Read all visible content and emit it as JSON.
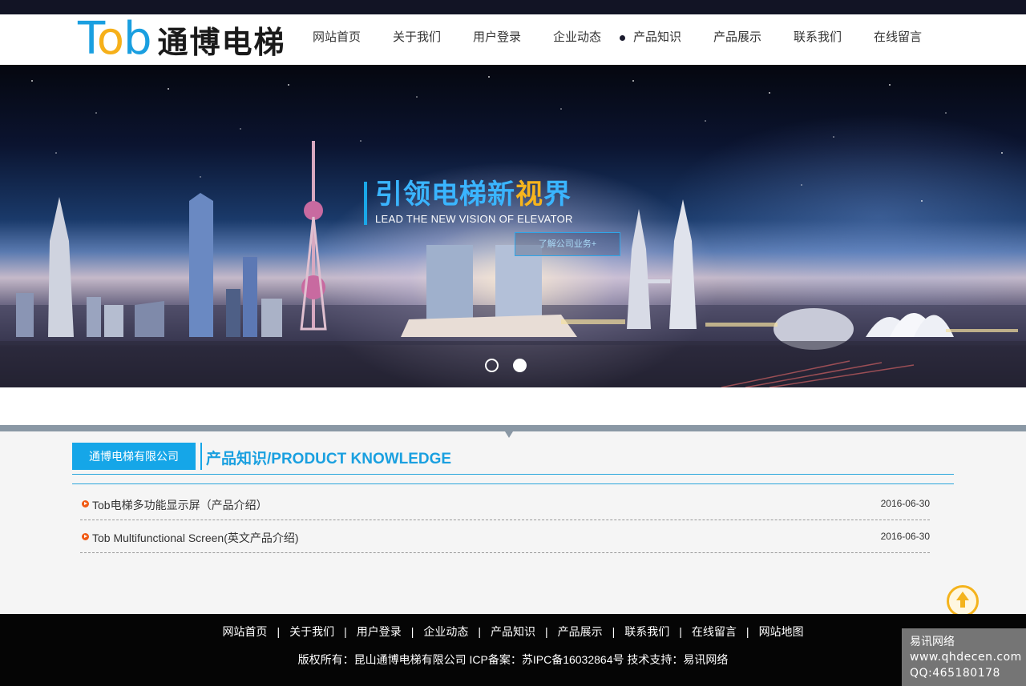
{
  "logo": {
    "en_part1": "T",
    "en_part2": "o",
    "en_part3": "b",
    "cn": "通博电梯"
  },
  "nav": {
    "items": [
      "网站首页",
      "关于我们",
      "用户登录",
      "企业动态",
      "产品知识",
      "产品展示",
      "联系我们",
      "在线留言"
    ],
    "active_index": 4
  },
  "banner": {
    "headline_cn_a": "引领电梯新",
    "headline_cn_b": "视",
    "headline_cn_c": "界",
    "headline_en": "LEAD THE NEW VISION OF ELEVATOR",
    "button_label": "了解公司业务+",
    "slide_count": 2,
    "active_slide": 2
  },
  "section": {
    "company_tab": "通博电梯有限公司",
    "title": "产品知识/PRODUCT KNOWLEDGE"
  },
  "list": [
    {
      "title": "Tob电梯多功能显示屏（产品介绍）",
      "date": "2016-06-30"
    },
    {
      "title": "Tob Multifunctional Screen(英文产品介绍)",
      "date": "2016-06-30"
    }
  ],
  "footer": {
    "links": [
      "网站首页",
      "关于我们",
      "用户登录",
      "企业动态",
      "产品知识",
      "产品展示",
      "联系我们",
      "在线留言",
      "网站地图"
    ],
    "copyright": "版权所有：昆山通博电梯有限公司   ICP备案：苏IPC备16032864号   技术支持：易讯网络"
  },
  "ad": {
    "line1": "易讯网络",
    "line2": "www.qhdecen.com",
    "line3": "QQ:465180178"
  },
  "colors": {
    "accent": "#15a6e8",
    "logo_yellow": "#f6b01a",
    "bullet": "#f05a14",
    "footer_bg": "#050505"
  },
  "icons": {
    "to_top": "arrow-up-circle-icon",
    "bullet": "play-bullet-icon"
  }
}
